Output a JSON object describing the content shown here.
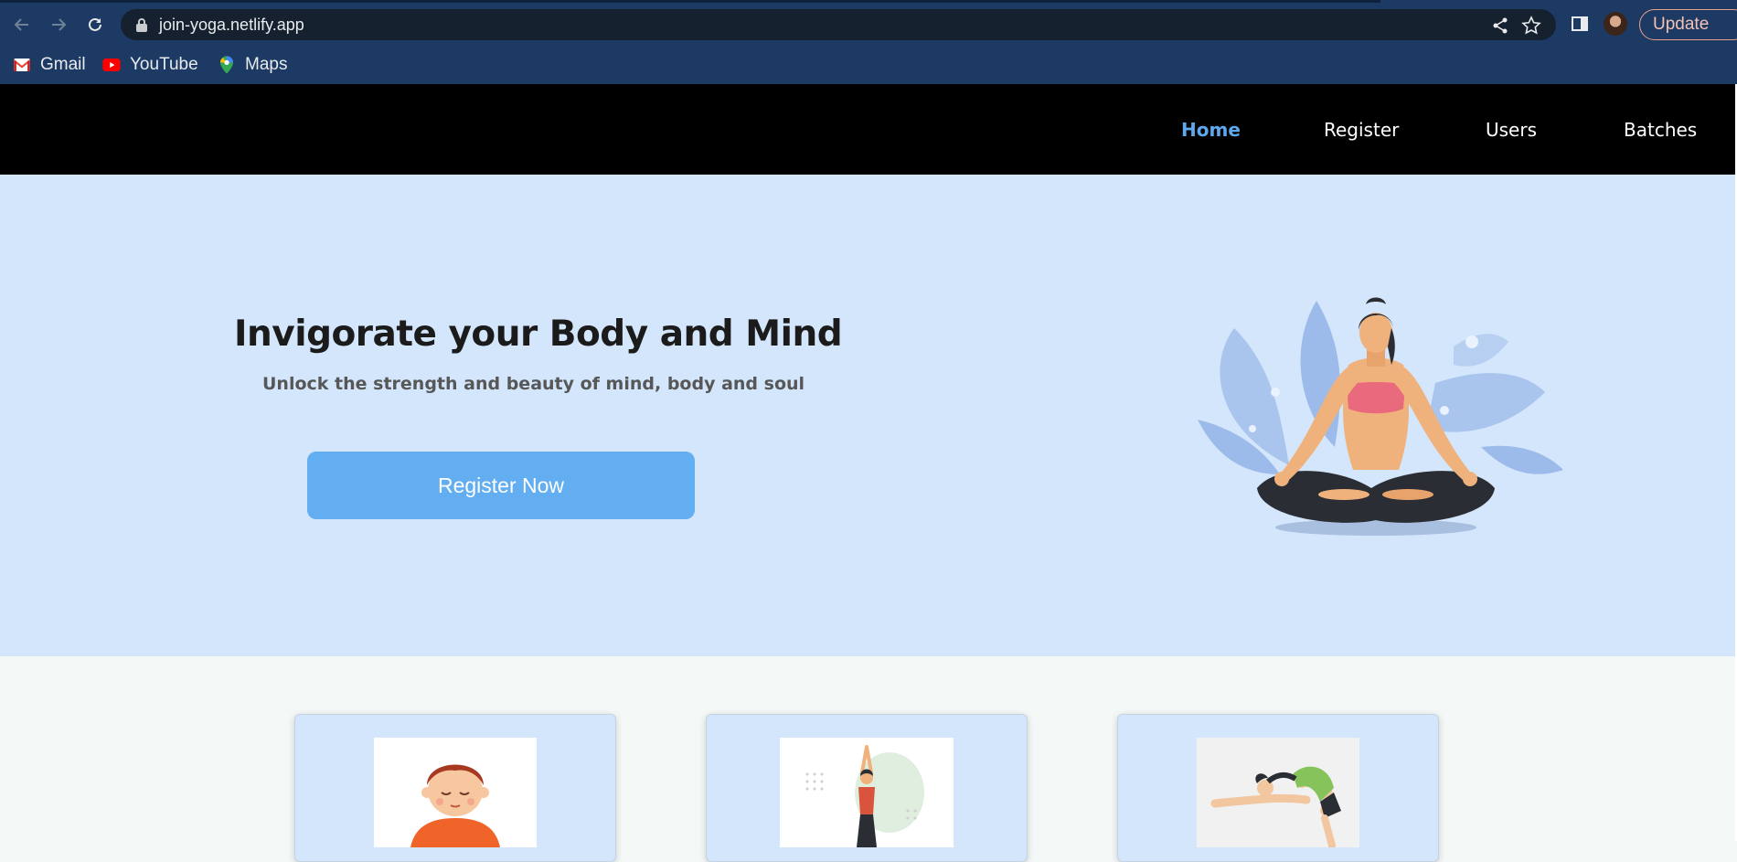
{
  "browser": {
    "url": "join-yoga.netlify.app",
    "update_label": "Update",
    "bookmarks": [
      {
        "label": "Gmail",
        "icon": "gmail-icon"
      },
      {
        "label": "YouTube",
        "icon": "youtube-icon"
      },
      {
        "label": "Maps",
        "icon": "maps-icon"
      }
    ]
  },
  "nav": {
    "items": [
      "Home",
      "Register",
      "Users",
      "Batches"
    ],
    "active": "Home"
  },
  "hero": {
    "title": "Invigorate your Body and Mind",
    "subtitle": "Unlock the strength and beauty of mind, body and soul",
    "cta": "Register Now",
    "illustration": "meditating-woman-illustration"
  },
  "cards": [
    {
      "image": "meditating-boy-illustration"
    },
    {
      "image": "tree-pose-woman-illustration"
    },
    {
      "image": "backbend-pose-illustration"
    }
  ],
  "colors": {
    "chrome": "#1c3a63",
    "nav_bg": "#000000",
    "nav_active": "#5ea8ee",
    "hero_bg": "#d3e6fb",
    "button": "#62aef0"
  }
}
